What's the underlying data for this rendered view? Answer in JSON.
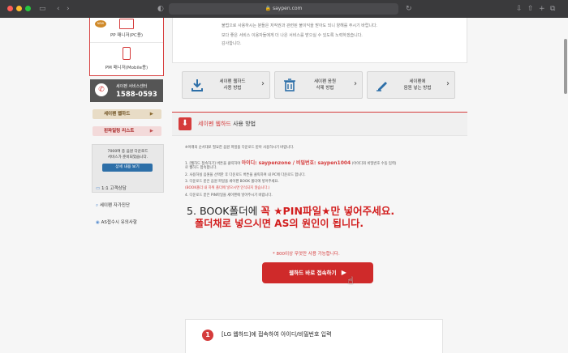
{
  "browser": {
    "url": "saypen.com",
    "traffic_colors": [
      "#ff5f57",
      "#febc2e",
      "#28c840"
    ]
  },
  "sidebar": {
    "new_badge": "NEW",
    "pp_label": "PP 매니저(PC용)",
    "pm_label": "PM 매니저(Mobile용)",
    "cs_label": "세이펜 서비스센터",
    "cs_phone": "1588-0593",
    "menu": [
      {
        "label": "세이펜 웹하드"
      },
      {
        "label": "핀파일링 리스트"
      }
    ],
    "promo_lines": [
      "7000여 종 음원 다운로드",
      "서비스가 준비되었습니다."
    ],
    "promo_button": "상세 내용 보기",
    "links": [
      {
        "label": "1:1 고객상담"
      },
      {
        "label": "세이펜 자가진단"
      },
      {
        "label": "AS접수시 유의사항"
      }
    ]
  },
  "notice": {
    "lines": [
      "불법으로 사용하시는 분들은 저작권과 관련된 불이익을 받아도 되니 양해를 주시기 바랍니다.",
      "보다 좋은 서비스 이용자들에게 더 나은 서비스를 받으실 수 있도록 노력하겠습니다.",
      "감사합니다."
    ]
  },
  "menu_buttons": [
    {
      "line1": "세이펜 웹하드",
      "line2": "사용 방법"
    },
    {
      "line1": "세이펜 음원",
      "line2": "삭제 방법"
    },
    {
      "line1": "세이펜에",
      "line2": "음원 넣는 방법"
    }
  ],
  "section": {
    "title_red": "세이펜 웹하드",
    "title_rest": " 사용 방법"
  },
  "body": {
    "intro": "※아래의 순서대로 필요한 음원 파일을 다운로드 받아 사용하시기 바랍니다.",
    "step1_pre": "1. [웹하드 접속하기] 버튼을 클릭하여 ",
    "step1_id": "아이디: saypenzone / 비밀번호: saypen1004",
    "step1_post": " (아이디와 비밀번호 수동 입력)",
    "step1_b": "로 웹하드 접속합니다.",
    "step2": "2. 사용하실 음원을 선택한 후 다운로드 버튼을 클릭하여 내 PC에 다운로드 합니다.",
    "step3": "3. 다운로드 받은 음원 파일을 세이펜 BOOK 폴더에 넣어주세요.",
    "step3_warn": "(BOOK폴더 내 하위 폴더에 넣으시면 인식되지 않습니다.)",
    "step4": "4. 다운로드 받은 PIN파일을 세이펜에 넣어주시기 바랍니다.",
    "big_pre": "5. BOOK폴더에 ",
    "big_red": "꼭 ★PIN파일★만 넣어주세요.",
    "big_line2": "폴더채로 넣으시면 AS의 원인이 됩니다."
  },
  "cta": {
    "note": "* 800이상 무엇만 사용 가능합니다.",
    "label": "웹하드 바로 접속하기"
  },
  "step_card": {
    "num": "1",
    "text": "[LG 웹하드]에 접속하여 아이디/비밀번호 입력"
  }
}
